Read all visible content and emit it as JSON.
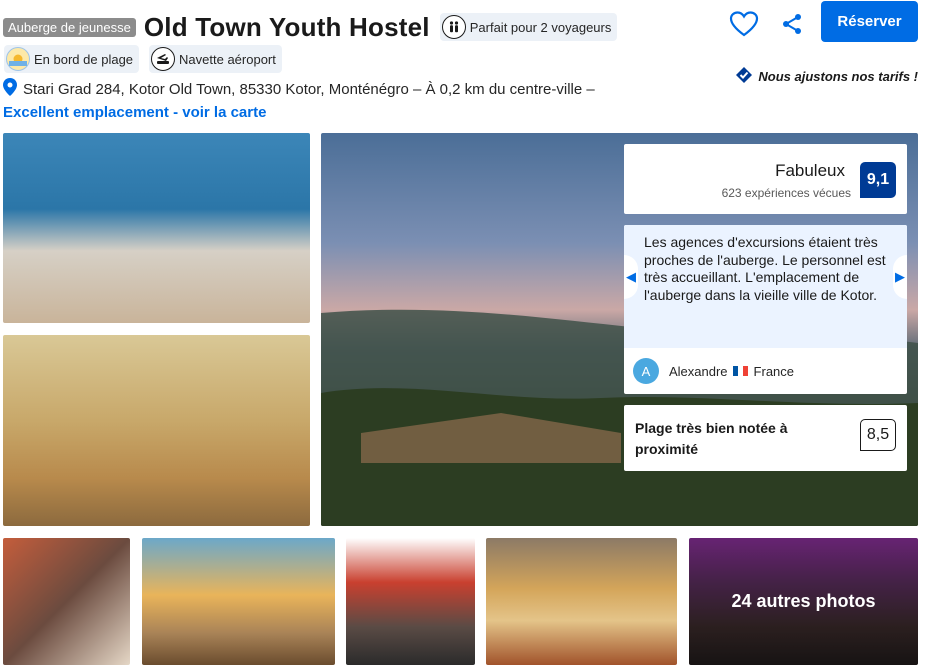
{
  "header": {
    "type_badge": "Auberge de jeunesse",
    "title": "Old Town Youth Hostel",
    "travelers_chip": "Parfait pour 2 voyageurs"
  },
  "facilities": [
    {
      "label": "En bord de plage",
      "icon": "beach-icon"
    },
    {
      "label": "Navette aéroport",
      "icon": "airport-shuttle-icon"
    }
  ],
  "actions": {
    "reserve_label": "Réserver",
    "price_match_note": "Nous ajustons nos tarifs !",
    "favorite_icon": "heart-icon",
    "share_icon": "share-icon"
  },
  "location": {
    "address": "Stari Grad 284, Kotor Old Town, 85330 Kotor, Monténégro – À 0,2 km du centre-ville –",
    "map_link": "Excellent emplacement - voir la carte"
  },
  "rating": {
    "label": "Fabuleux",
    "reviews": "623 expériences vécues",
    "score": "9,1"
  },
  "review": {
    "text": "Les agences d'excursions étaient très proches de l'auberge. Le personnel est très accueillant. L'emplacement de l'auberge dans la vieille ville de Kotor.",
    "avatar_initial": "A",
    "author": "Alexandre",
    "country": "France"
  },
  "beach": {
    "label": "Plage très bien notée à proximité",
    "score": "8,5"
  },
  "gallery": {
    "more_photos": "24 autres photos"
  },
  "colors": {
    "primary": "#006ce4",
    "score_bg": "#003b95",
    "review_bg": "#ebf3ff"
  }
}
